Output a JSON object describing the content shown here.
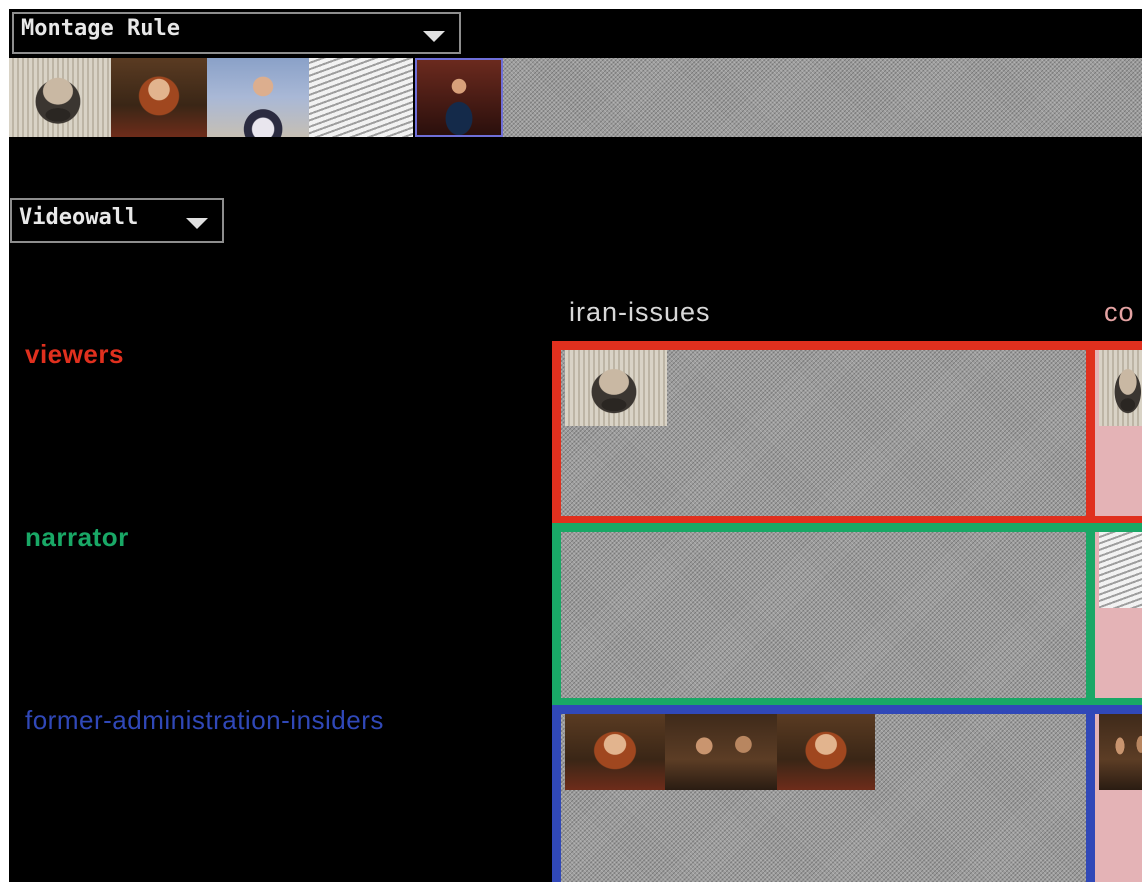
{
  "montage_dropdown": {
    "label": "Montage Rule"
  },
  "videowall_dropdown": {
    "label": "Videowall"
  },
  "clip_strip": {
    "clips": [
      "man-with-newspaper",
      "woman-red-hair",
      "man-in-suit",
      "newspaper-page",
      "news-anchor"
    ],
    "selected_index": 4
  },
  "videowall": {
    "columns": [
      "iran-issues",
      "co"
    ],
    "rows": [
      {
        "label": "viewers",
        "color": "#e0301e"
      },
      {
        "label": "narrator",
        "color": "#19a866"
      },
      {
        "label": "former-administration-insiders",
        "color": "#3048b8"
      }
    ]
  },
  "colors": {
    "background": "#000000",
    "viewers": "#e0301e",
    "narrator": "#19a866",
    "insiders": "#3048b8",
    "column2_header": "#e4a3a3"
  }
}
